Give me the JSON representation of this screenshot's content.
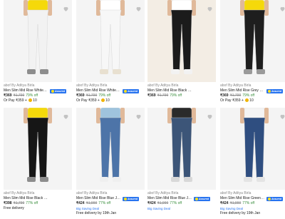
{
  "colors": {
    "accent": "#2874f0",
    "discount": "#388e3c",
    "muted": "#878787"
  },
  "products": [
    {
      "brand": "abof By Aditya Birla",
      "name": "Men Slim Mid Rise White Jea...",
      "price": "₹369",
      "mrp": "₹1,799",
      "discount": "79% off",
      "extra": "Or Pay ₹359 + ",
      "coins": "10",
      "assured": "Assured",
      "shirt": "#f5d90a",
      "jeans": "#f2f2f2",
      "shoes": "#8d8d8d"
    },
    {
      "brand": "abof By Aditya Birla",
      "name": "Men Slim Mid Rise White Jea...",
      "price": "₹369",
      "mrp": "₹1,799",
      "discount": "79% off",
      "extra": "Or Pay ₹359 + ",
      "coins": "10",
      "assured": "Assured",
      "shirt": "#ffffff",
      "jeans": "#f7f7f7",
      "shoes": "#e8e0d0"
    },
    {
      "brand": "abof By Aditya Birla",
      "name": "Men Slim Mid Rise Black Jea...",
      "price": "₹369",
      "mrp": "₹1,799",
      "discount": "79% off",
      "extra": "",
      "coins": "",
      "assured": "",
      "shirt": "#ffffff",
      "jeans": "#1b1b1b",
      "shoes": "#f2f2f2"
    },
    {
      "brand": "abof By Aditya Birla",
      "name": "Men Slim Mid Rise Grey Jeans",
      "price": "₹369",
      "mrp": "₹1,799",
      "discount": "79% off",
      "extra": "Or Pay ₹359 + ",
      "coins": "10",
      "assured": "Assured",
      "shirt": "#f5d90a",
      "jeans": "#1e1e1e",
      "shoes": "#9a9a9a"
    },
    {
      "brand": "abof By Aditya Birla",
      "name": "Men Slim Mid Rise Black Jeans",
      "price": "₹398",
      "mrp": "₹1,799",
      "discount": "77% off",
      "extra": "",
      "coins": "",
      "assured": "",
      "delivery": "Free delivery",
      "shirt": "#f5d90a",
      "jeans": "#161616",
      "shoes": "#8d8d8d"
    },
    {
      "brand": "abof By Aditya Birla",
      "name": "Men Slim Mid Rise Blue Jeans",
      "price": "₹424",
      "mrp": "₹1,999",
      "discount": "77% off",
      "extra": "",
      "coins": "",
      "assured": "Assured",
      "delivery": "Free delivery by 19th Jan",
      "deal": "Big Saving Deal",
      "shirt": "#9fc3dd",
      "jeans": "#4d74a8",
      "shoes": "#efefef"
    },
    {
      "brand": "abof By Aditya Birla",
      "name": "Men Slim Mid Rise Blue Jeans",
      "price": "₹424",
      "mrp": "₹1,999",
      "discount": "77% off",
      "extra": "",
      "coins": "",
      "assured": "Assured",
      "delivery": "",
      "deal": "Big Saving Deal",
      "shirt": "#2a2a2a",
      "jeans": "#3c5578",
      "shoes": "#d8d8d8"
    },
    {
      "brand": "abof By Aditya Birla",
      "name": "Men Slim Mid Rise Green Jeans",
      "price": "₹424",
      "mrp": "₹1,999",
      "discount": "77% off",
      "extra": "",
      "coins": "",
      "assured": "Assured",
      "delivery": "Free delivery by 19th Jan",
      "deal": "Big Saving Deal",
      "shirt": "#f4f4f4",
      "jeans": "#2f4e80",
      "shoes": "#e4e4e4"
    }
  ]
}
